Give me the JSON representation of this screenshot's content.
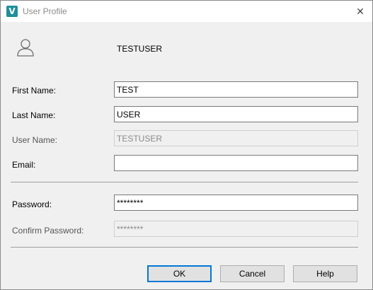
{
  "window": {
    "title": "User Profile",
    "app_icon_letter": "V",
    "close_glyph": "✕"
  },
  "header": {
    "username": "TESTUSER"
  },
  "form": {
    "first_name": {
      "label": "First Name:",
      "value": "TEST"
    },
    "last_name": {
      "label": "Last Name:",
      "value": "USER"
    },
    "user_name": {
      "label": "User Name:",
      "value": "TESTUSER",
      "disabled": true
    },
    "email": {
      "label": "Email:",
      "value": ""
    },
    "password": {
      "label": "Password:",
      "value": "********"
    },
    "confirm_password": {
      "label": "Confirm Password:",
      "value": "********",
      "disabled": true
    }
  },
  "buttons": {
    "ok": "OK",
    "cancel": "Cancel",
    "help": "Help"
  },
  "colors": {
    "accent": "#0078d7",
    "app_icon": "#1f8f9a"
  },
  "icons": [
    "app-logo-icon",
    "close-icon",
    "user-avatar-icon"
  ]
}
